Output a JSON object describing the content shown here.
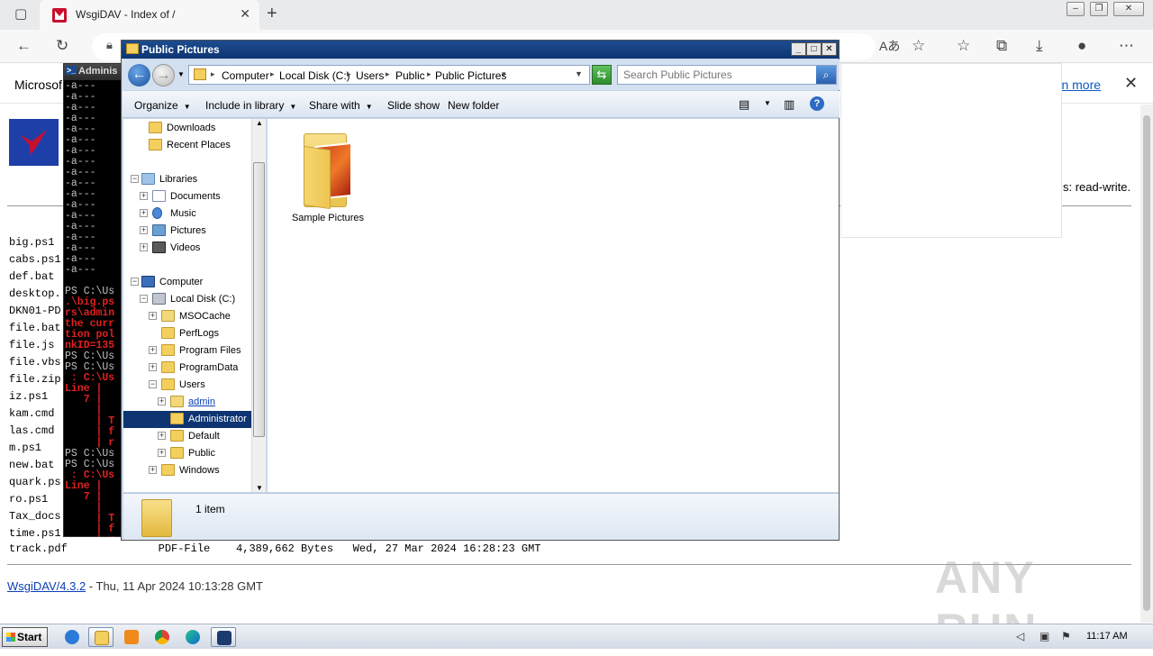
{
  "browser": {
    "tab_title": "WsgiDAV - Index of /",
    "infobar_text": "Microsof",
    "learn_more": "arn more",
    "readwrite_text": "s: read-write."
  },
  "listing": {
    "files": [
      "big.ps1",
      "cabs.ps1",
      "def.bat",
      "desktop.",
      "DKN01-PD",
      "file.bat",
      "file.js",
      "file.vbs",
      "file.zip",
      "iz.ps1",
      "kam.cmd",
      "las.cmd",
      "m.ps1",
      "new.bat",
      "quark.ps",
      "ro.ps1",
      "Tax_docs",
      "time.ps1"
    ],
    "last_row": "track.pdf              PDF-File    4,389,662 Bytes   Wed, 27 Mar 2024 16:28:23 GMT",
    "footer_link": "WsgiDAV/4.3.2",
    "footer_text": " - Thu, 11 Apr 2024 10:13:28 GMT"
  },
  "watermark": "ANY RUN",
  "powershell": {
    "title": "Adminis",
    "lines": [
      {
        "t": "-a---",
        "red": false
      },
      {
        "t": "-a---",
        "red": false
      },
      {
        "t": "-a---",
        "red": false
      },
      {
        "t": "-a---",
        "red": false
      },
      {
        "t": "-a---",
        "red": false
      },
      {
        "t": "-a---",
        "red": false
      },
      {
        "t": "-a---",
        "red": false
      },
      {
        "t": "-a---",
        "red": false
      },
      {
        "t": "-a---",
        "red": false
      },
      {
        "t": "-a---",
        "red": false
      },
      {
        "t": "-a---",
        "red": false
      },
      {
        "t": "-a---",
        "red": false
      },
      {
        "t": "-a---",
        "red": false
      },
      {
        "t": "-a---",
        "red": false
      },
      {
        "t": "-a---",
        "red": false
      },
      {
        "t": "-a---",
        "red": false
      },
      {
        "t": "-a---",
        "red": false
      },
      {
        "t": "-a---",
        "red": false
      },
      {
        "t": "",
        "red": false
      },
      {
        "t": "PS C:\\Us",
        "red": false
      },
      {
        "t": ".\\big.ps",
        "red": true
      },
      {
        "t": "rs\\admin",
        "red": true
      },
      {
        "t": "the curr",
        "red": true
      },
      {
        "t": "tion pol",
        "red": true
      },
      {
        "t": "nkID=135",
        "red": true
      },
      {
        "t": "PS C:\\Us",
        "red": false
      },
      {
        "t": "PS C:\\Us",
        "red": false
      },
      {
        "t": " : C:\\Us",
        "red": true
      },
      {
        "t": "Line |",
        "red": true
      },
      {
        "t": "   7 |",
        "red": true
      },
      {
        "t": "     |",
        "red": true
      },
      {
        "t": "     | T",
        "red": true
      },
      {
        "t": "     | f",
        "red": true
      },
      {
        "t": "     | r",
        "red": true
      },
      {
        "t": "PS C:\\Us",
        "red": false
      },
      {
        "t": "PS C:\\Us",
        "red": false
      },
      {
        "t": " : C:\\Us",
        "red": true
      },
      {
        "t": "Line |",
        "red": true
      },
      {
        "t": "   7 |",
        "red": true
      },
      {
        "t": "     |",
        "red": true
      },
      {
        "t": "     | T",
        "red": true
      },
      {
        "t": "     | f",
        "red": true
      },
      {
        "t": "     | r",
        "red": true
      },
      {
        "t": "PS C:\\Us",
        "red": false
      }
    ]
  },
  "explorer": {
    "title": "Public Pictures",
    "breadcrumb": [
      "Computer",
      "Local Disk (C:)",
      "Users",
      "Public",
      "Public Pictures"
    ],
    "search_placeholder": "Search Public Pictures",
    "commands": {
      "organize": "Organize",
      "include": "Include in library",
      "share": "Share with",
      "slideshow": "Slide show",
      "newfolder": "New folder"
    },
    "tree": {
      "downloads": "Downloads",
      "recent": "Recent Places",
      "libraries": "Libraries",
      "documents": "Documents",
      "music": "Music",
      "pictures": "Pictures",
      "videos": "Videos",
      "computer": "Computer",
      "localdisk": "Local Disk (C:)",
      "msocache": "MSOCache",
      "perflogs": "PerfLogs",
      "programfiles": "Program Files",
      "programdata": "ProgramData",
      "users": "Users",
      "admin": "admin",
      "administrator": "Administrator",
      "default": "Default",
      "public": "Public",
      "windows": "Windows"
    },
    "item_name": "Sample Pictures",
    "status": "1 item"
  },
  "taskbar": {
    "start": "Start",
    "clock": "11:17 AM"
  }
}
